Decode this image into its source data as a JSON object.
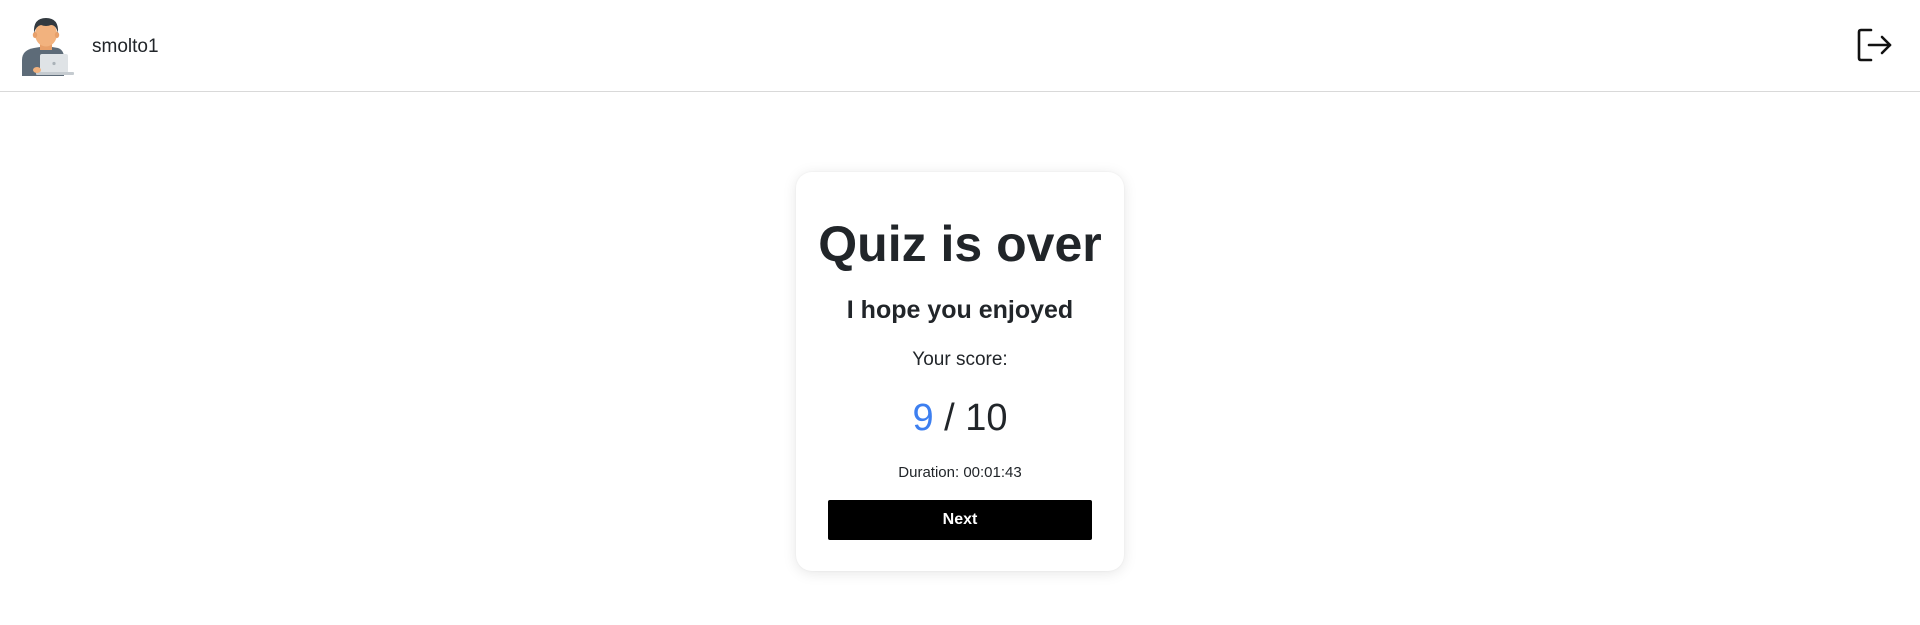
{
  "header": {
    "username": "smolto1",
    "avatar_icon": "user-with-laptop-icon",
    "logout_icon": "logout-icon"
  },
  "result": {
    "title": "Quiz is over",
    "subtitle": "I hope you enjoyed",
    "score_label": "Your score:",
    "score": "9",
    "separator": " / ",
    "total": "10",
    "duration": "Duration: 00:01:43",
    "next_label": "Next"
  },
  "colors": {
    "score_accent": "#3d7ff0",
    "button_bg": "#000000",
    "button_text": "#ffffff"
  }
}
